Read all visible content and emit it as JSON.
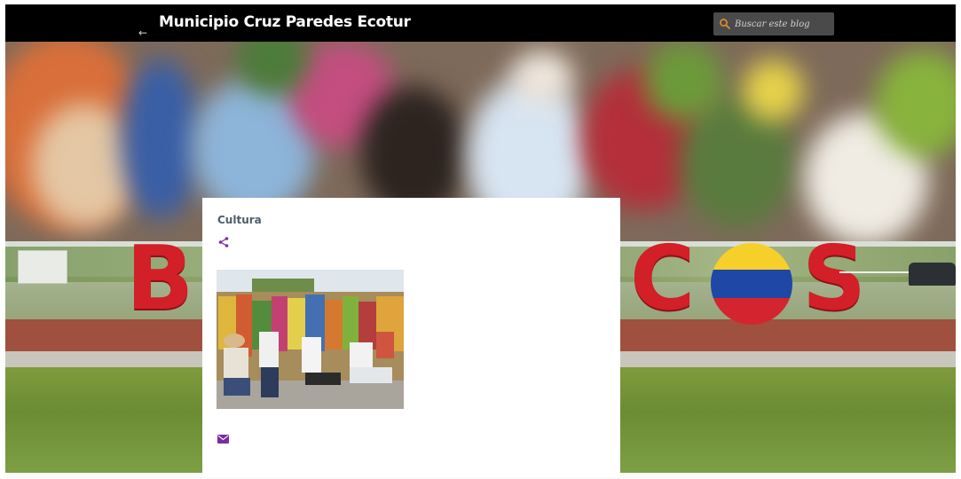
{
  "header": {
    "blog_title": "Municipio Cruz Paredes Ecotur",
    "search_placeholder": "Buscar este blog",
    "back_icon": "arrow-left-icon",
    "search_icon": "search-icon"
  },
  "hero": {
    "sign_letters": [
      "B",
      "C",
      "S"
    ]
  },
  "post": {
    "title": "Cultura",
    "share_icon": "share-icon",
    "email_icon": "email-icon"
  },
  "colors": {
    "header_bg": "#000000",
    "title_text": "#ffffff",
    "search_bg": "#4a4a4a",
    "search_icon_accent": "#e0892a",
    "post_title": "#4e5d6e",
    "icon_accent": "#7a2da0",
    "sign_red": "#d21f28"
  }
}
